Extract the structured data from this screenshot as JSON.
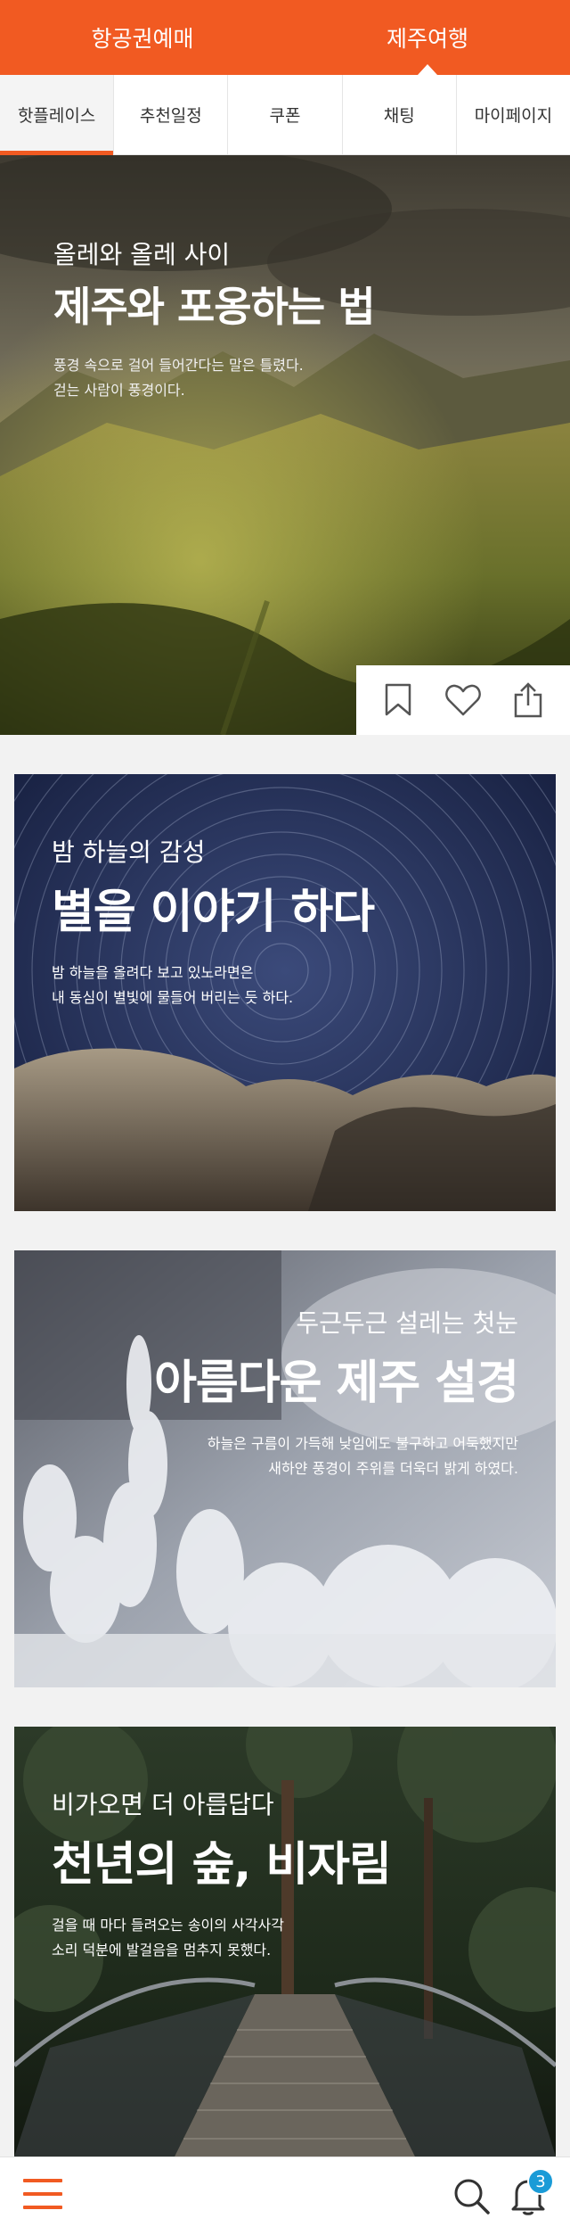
{
  "topbar": {
    "tabs": [
      {
        "label": "항공권예매"
      },
      {
        "label": "제주여행"
      }
    ]
  },
  "subtabs": [
    {
      "label": "핫플레이스"
    },
    {
      "label": "추천일정"
    },
    {
      "label": "쿠폰"
    },
    {
      "label": "채팅"
    },
    {
      "label": "마이페이지"
    }
  ],
  "hero": {
    "subtitle": "올레와 올레 사이",
    "title": "제주와 포옹하는 법",
    "desc_line1": "풍경 속으로 걸어 들어간다는 말은 틀렸다.",
    "desc_line2": "걷는 사람이 풍경이다.",
    "actions": [
      "bookmark-icon",
      "heart-icon",
      "share-icon"
    ]
  },
  "cards": [
    {
      "subtitle": "밤 하늘의 감성",
      "title": "별을 이야기 하다",
      "desc_line1": "밤 하늘을 올려다 보고 있노라면은",
      "desc_line2": "내 동심이 별빛에 물들어 버리는 듯 하다."
    },
    {
      "subtitle": "두근두근 설레는 첫눈",
      "title": "아름다운 제주 설경",
      "desc_line1": "하늘은 구름이 가득해 낮임에도 불구하고 어둑했지만",
      "desc_line2": "새하얀 풍경이 주위를 더욱더 밝게 하였다."
    },
    {
      "subtitle": "비가오면 더 아릅답다",
      "title": "천년의 숲, 비자림",
      "desc_line1": "걸을 때 마다 들려오는 송이의 사각사각",
      "desc_line2": "소리 덕분에 발걸음을 멈추지 못했다."
    }
  ],
  "bottombar": {
    "notification_count": "3"
  },
  "colors": {
    "accent": "#f15a22",
    "badge": "#1a9bd7"
  }
}
